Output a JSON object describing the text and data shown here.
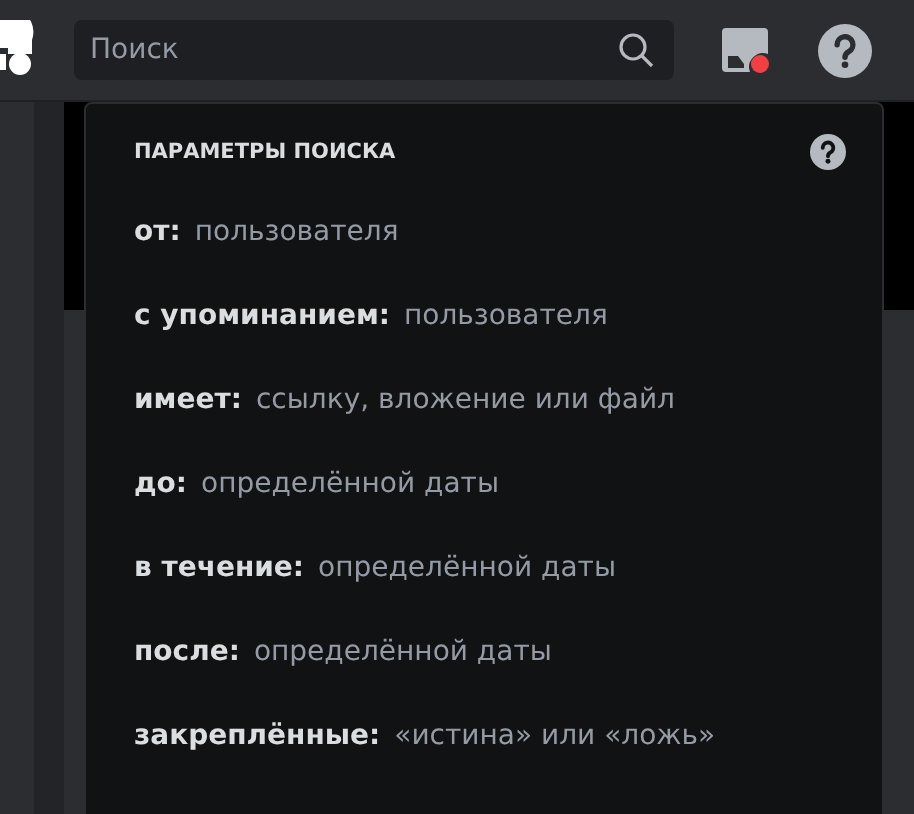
{
  "search": {
    "placeholder": "Поиск"
  },
  "search_options": {
    "title": "ПАРАМЕТРЫ ПОИСКА",
    "options": [
      {
        "key": "от:",
        "value": "пользователя"
      },
      {
        "key": "с упоминанием:",
        "value": "пользователя"
      },
      {
        "key": "имеет:",
        "value": "ссылку, вложение или файл"
      },
      {
        "key": "до:",
        "value": "определённой даты"
      },
      {
        "key": "в течение:",
        "value": "определённой даты"
      },
      {
        "key": "после:",
        "value": "определённой даты"
      },
      {
        "key": "закреплённые:",
        "value": "«истина» или «ложь»"
      }
    ]
  }
}
